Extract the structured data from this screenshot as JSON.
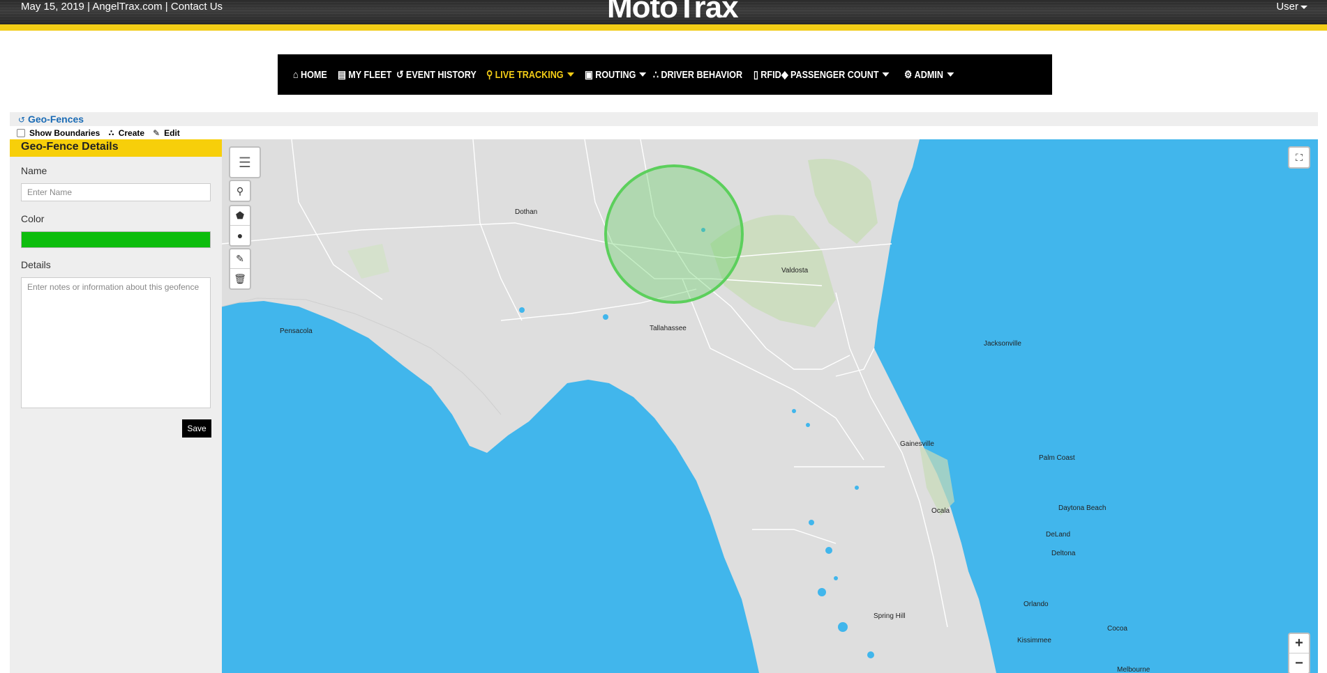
{
  "header": {
    "date": "May 15, 2019",
    "site": "AngelTrax.com",
    "contact": "Contact Us",
    "separator": " | ",
    "logo": "MotoTrax",
    "user": "User"
  },
  "nav": {
    "items": [
      {
        "label": "HOME",
        "icon": "home-icon"
      },
      {
        "label": "MY FLEET",
        "icon": "bus-icon"
      },
      {
        "label": "EVENT HISTORY",
        "icon": "history-icon"
      },
      {
        "label": "LIVE TRACKING",
        "icon": "map-pin-icon",
        "active": true,
        "dropdown": true
      },
      {
        "label": "ROUTING",
        "icon": "map-icon",
        "dropdown": true
      },
      {
        "label": "DRIVER BEHAVIOR",
        "icon": "sitemap-icon"
      },
      {
        "label": "RFID",
        "icon": "id-card-icon"
      },
      {
        "label": "PASSENGER COUNT",
        "icon": "ticket-icon",
        "dropdown": true
      },
      {
        "label": "ADMIN",
        "icon": "cog-icon",
        "dropdown": true
      }
    ],
    "active_color": "#f2cc16"
  },
  "subheader": {
    "title": "Geo-Fences",
    "show_boundaries": "Show Boundaries",
    "create": "Create",
    "edit": "Edit"
  },
  "panel": {
    "title": "Geo-Fence Details",
    "name_label": "Name",
    "name_placeholder": "Enter Name",
    "color_label": "Color",
    "color_value": "#0dbd0d",
    "details_label": "Details",
    "details_placeholder": "Enter notes or information about this geofence",
    "save": "Save"
  },
  "map": {
    "cities": [
      "Dothan",
      "Valdosta",
      "Pensacola",
      "Tallahassee",
      "Jacksonville",
      "Gainesville",
      "Palm Coast",
      "Daytona Beach",
      "Ocala",
      "DeLand",
      "Deltona",
      "Spring Hill",
      "Orlando",
      "Kissimmee",
      "Cocoa",
      "Melbourne"
    ],
    "geofence_color": "#5ccf5c",
    "zoom_in": "+",
    "zoom_out": "−"
  }
}
